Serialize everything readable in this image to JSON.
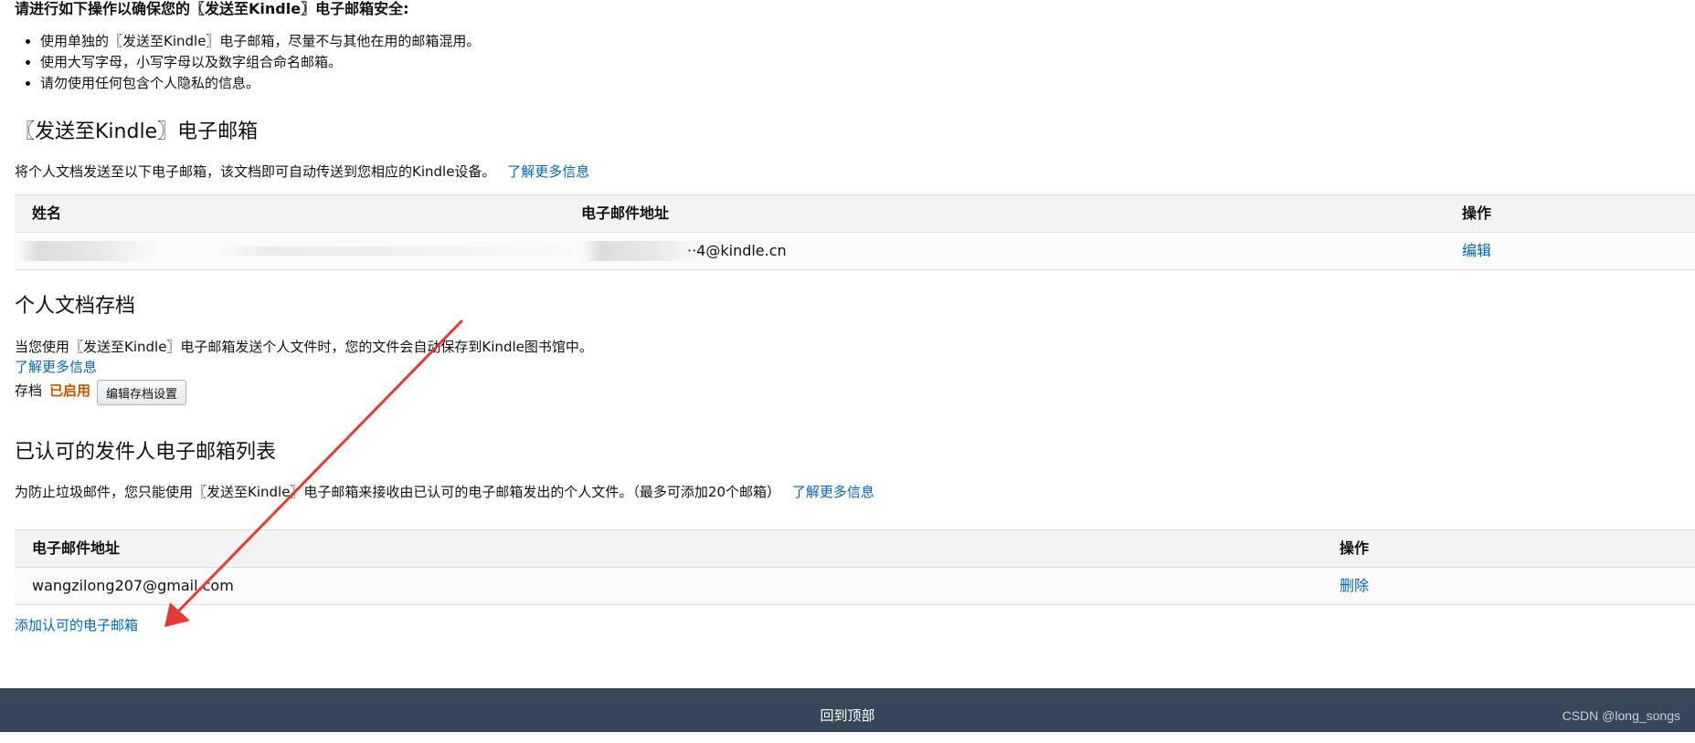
{
  "security_tips": {
    "title": "请进行如下操作以确保您的〖发送至Kindle〗电子邮箱安全:",
    "items": [
      "使用单独的〖发送至Kindle〗电子邮箱，尽量不与其他在用的邮箱混用。",
      "使用大写字母，小写字母以及数字组合命名邮箱。",
      "请勿使用任何包含个人隐私的信息。"
    ]
  },
  "send_to_kindle": {
    "title": "〖发送至Kindle〗电子邮箱",
    "description": "将个人文档发送至以下电子邮箱，该文档即可自动传送到您相应的Kindle设备。",
    "learn_more": "了解更多信息",
    "columns": [
      "姓名",
      "电子邮件地址",
      "操作"
    ],
    "rows": [
      {
        "name": "",
        "email": "··4@kindle.cn",
        "action": "编辑"
      }
    ]
  },
  "archive": {
    "title": "个人文档存档",
    "description": "当您使用〖发送至Kindle〗电子邮箱发送个人文件时，您的文件会自动保存到Kindle图书馆中。",
    "learn_more": "了解更多信息",
    "label": "存档",
    "status": "已启用",
    "button_label": "编辑存档设置"
  },
  "approved_senders": {
    "title": "已认可的发件人电子邮箱列表",
    "description": "为防止垃圾邮件，您只能使用〖发送至Kindle〗电子邮箱来接收由已认可的电子邮箱发出的个人文件。（最多可添加20个邮箱）",
    "learn_more": "了解更多信息",
    "columns": [
      "电子邮件地址",
      "操作"
    ],
    "rows": [
      {
        "email": "wangzilong207@gmail.com",
        "action": "删除"
      }
    ],
    "add_link": "添加认可的电子邮箱"
  },
  "footer": {
    "back_to_top": "回到顶部",
    "watermark": "CSDN @long_songs"
  },
  "colors": {
    "link": "#0066c0",
    "status": "#c45500",
    "footer_bg": "#37475a",
    "annotation_arrow": "#e53935"
  }
}
